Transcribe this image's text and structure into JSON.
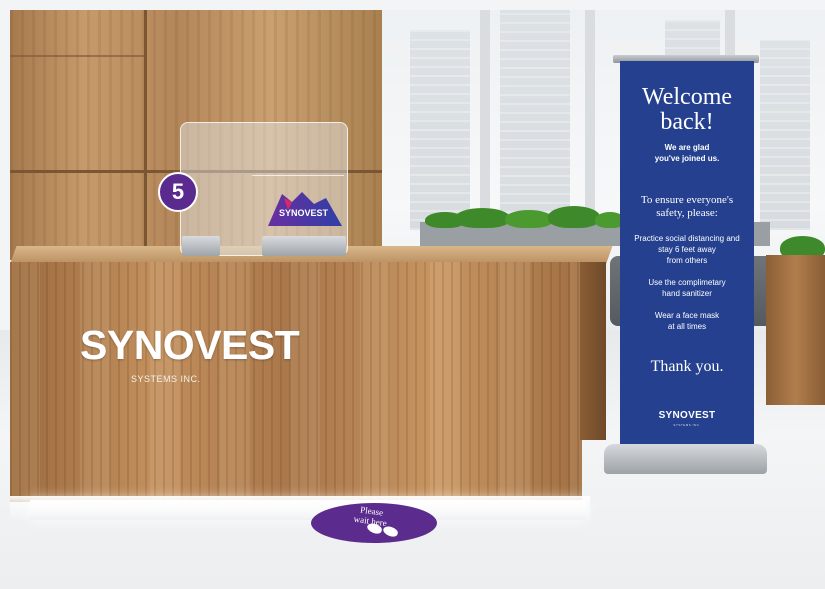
{
  "scene": {
    "brand_color": "#5b2c8d",
    "banner_color": "#24408f"
  },
  "desk": {
    "logo": "SYNOVEST",
    "tagline": "SYSTEMS INC."
  },
  "counter": {
    "number": "5"
  },
  "sneeze_guard": {
    "logo": "SYNOVEST"
  },
  "floor_decal": {
    "line1": "Please",
    "line2": "wait here"
  },
  "banner": {
    "title_line1": "Welcome",
    "title_line2": "back!",
    "subtitle_line1": "We are glad",
    "subtitle_line2": "you've joined us.",
    "heading_line1": "To ensure everyone's",
    "heading_line2": "safety, please:",
    "item1_line1": "Practice social distancing and",
    "item1_line2": "stay 6 feet away",
    "item1_line3": "from others",
    "item2_line1": "Use the complimetary",
    "item2_line2": "hand sanitizer",
    "item3_line1": "Wear a face mask",
    "item3_line2": "at all times",
    "closing": "Thank you.",
    "logo": "SYNOVEST",
    "logo_tagline": "SYSTEMS INC."
  }
}
